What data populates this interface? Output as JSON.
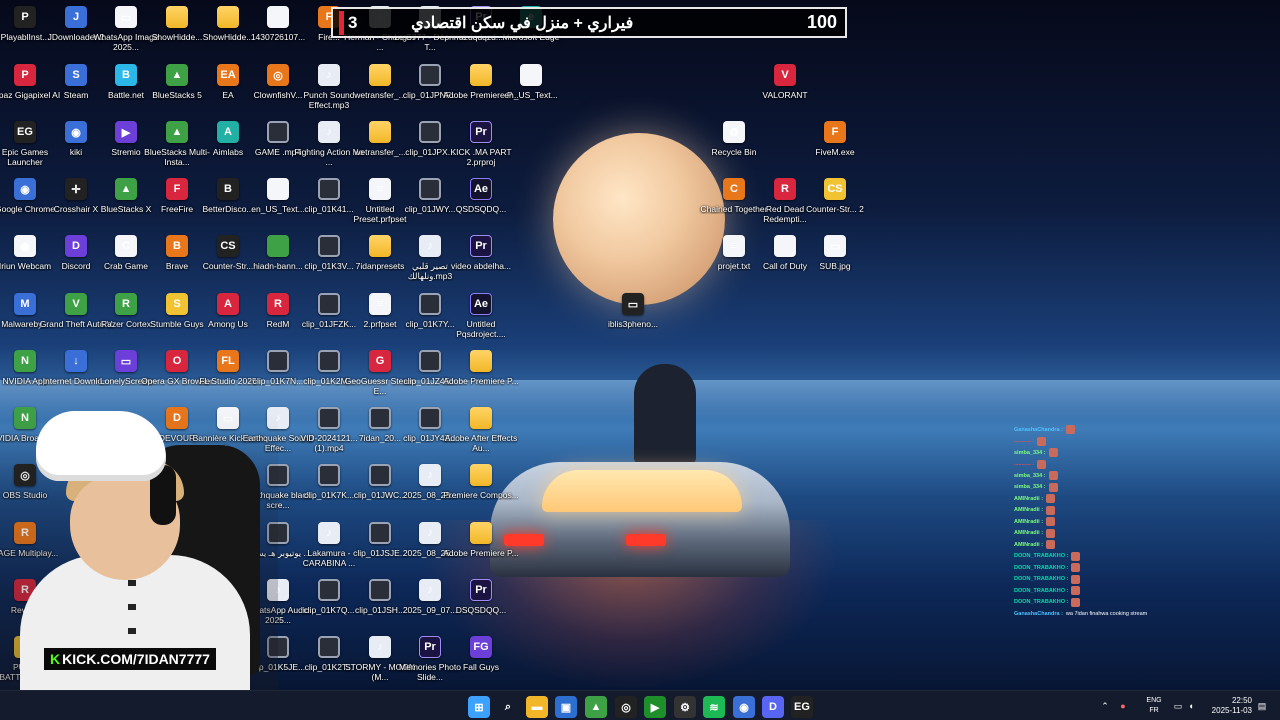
{
  "banner": {
    "left_count": "3",
    "title": "فيراري + منزل في سكن اقتصادي",
    "right_count": "100"
  },
  "overlay": {
    "kick_prefix": "K",
    "kick_text": "KICK.COM/7IDAN7777"
  },
  "desktop": {
    "icons": [
      {
        "label": "PlayablInst...",
        "icon": "steam-icon",
        "kind": "dark",
        "glyph": "P"
      },
      {
        "label": "JDownloader 2",
        "icon": "jdownloader-icon",
        "kind": "app",
        "glyph": "J"
      },
      {
        "label": "WhatsApp Image 2025...",
        "icon": "image-icon",
        "kind": "doc",
        "glyph": "▭"
      },
      {
        "label": "ShowHidde...",
        "icon": "folder-icon",
        "kind": "folder",
        "glyph": ""
      },
      {
        "label": "ShowHidde...",
        "icon": "folder-icon",
        "kind": "folder",
        "glyph": ""
      },
      {
        "label": "1430726107...",
        "icon": "file-icon",
        "kind": "doc",
        "glyph": ""
      },
      {
        "label": "Fire...",
        "icon": "firefox-icon",
        "kind": "orange",
        "glyph": "F"
      },
      {
        "label": "Herman - Changes ...",
        "icon": "audio-icon",
        "kind": "audio",
        "glyph": "♪"
      },
      {
        "label": "Le S777 - Déprimé T...",
        "icon": "audio-icon",
        "kind": "audio",
        "glyph": "♪"
      },
      {
        "label": "azdqdqzd...",
        "icon": "premiere-icon",
        "kind": "pr",
        "glyph": "Pr"
      },
      {
        "label": "Microsoft Edge",
        "icon": "edge-icon",
        "kind": "teal",
        "glyph": "e"
      },
      {
        "label": "Topaz Gigapixel AI",
        "icon": "topaz-icon",
        "kind": "red",
        "glyph": "P"
      },
      {
        "label": "Steam",
        "icon": "steam-icon",
        "kind": "app",
        "glyph": "S"
      },
      {
        "label": "Battle.net",
        "icon": "battlenet-icon",
        "kind": "cyan",
        "glyph": "B"
      },
      {
        "label": "BlueStacks 5",
        "icon": "bluestacks-icon",
        "kind": "green",
        "glyph": "▲"
      },
      {
        "label": "EA",
        "icon": "ea-icon",
        "kind": "orange",
        "glyph": "EA"
      },
      {
        "label": "ClownfishV...",
        "icon": "clownfish-icon",
        "kind": "orange",
        "glyph": "◎"
      },
      {
        "label": "Punch Sound Effect.mp3",
        "icon": "audio-icon",
        "kind": "audio",
        "glyph": "♪"
      },
      {
        "label": "wetransfer_...",
        "icon": "folder-icon",
        "kind": "folder",
        "glyph": ""
      },
      {
        "label": "clip_01JPNF...",
        "icon": "video-icon",
        "kind": "video",
        "glyph": ""
      },
      {
        "label": "Adobe Premiere P...",
        "icon": "folder-icon",
        "kind": "folder",
        "glyph": ""
      },
      {
        "label": "en_US_Text...",
        "icon": "file-icon",
        "kind": "doc",
        "glyph": ""
      },
      {
        "label": "VALORANT",
        "icon": "valorant-icon",
        "kind": "red",
        "glyph": "V"
      },
      {
        "label": "Epic Games Launcher",
        "icon": "epic-games-icon",
        "kind": "dark",
        "glyph": "EG"
      },
      {
        "label": "kiki",
        "icon": "chrome-icon",
        "kind": "app",
        "glyph": "◉"
      },
      {
        "label": "Stremio",
        "icon": "stremio-icon",
        "kind": "purple",
        "glyph": "▶"
      },
      {
        "label": "BlueStacks Multi-Insta...",
        "icon": "bluestacks-icon",
        "kind": "green",
        "glyph": "▲"
      },
      {
        "label": "Aimlabs",
        "icon": "aimlabs-icon",
        "kind": "teal",
        "glyph": "A"
      },
      {
        "label": "GAME .mp4",
        "icon": "video-icon",
        "kind": "video",
        "glyph": ""
      },
      {
        "label": "Fighting Action No ...",
        "icon": "audio-icon",
        "kind": "audio",
        "glyph": "♪"
      },
      {
        "label": "wetransfer_...",
        "icon": "folder-icon",
        "kind": "folder",
        "glyph": ""
      },
      {
        "label": "clip_01JPX...",
        "icon": "video-icon",
        "kind": "video",
        "glyph": ""
      },
      {
        "label": "KICK .MA PART 2.prproj",
        "icon": "premiere-icon",
        "kind": "pr",
        "glyph": "Pr"
      },
      {
        "label": "Recycle Bin",
        "icon": "recycle-bin-icon",
        "kind": "doc",
        "glyph": "♻"
      },
      {
        "label": "FiveM.exe",
        "icon": "fivem-icon",
        "kind": "orange",
        "glyph": "F"
      },
      {
        "label": "Google Chrome",
        "icon": "chrome-icon",
        "kind": "app",
        "glyph": "◉"
      },
      {
        "label": "Crosshair X",
        "icon": "crosshair-icon",
        "kind": "dark",
        "glyph": "✛"
      },
      {
        "label": "BlueStacks X",
        "icon": "bluestacks-icon",
        "kind": "green",
        "glyph": "▲"
      },
      {
        "label": "FreeFire",
        "icon": "freefire-icon",
        "kind": "red",
        "glyph": "F"
      },
      {
        "label": "BetterDisco...",
        "icon": "discord-icon",
        "kind": "dark",
        "glyph": "B"
      },
      {
        "label": "en_US_Text...",
        "icon": "file-icon",
        "kind": "doc",
        "glyph": ""
      },
      {
        "label": "clip_01K41...",
        "icon": "video-icon",
        "kind": "video",
        "glyph": ""
      },
      {
        "label": "Untitled Preset.prfpset",
        "icon": "preset-icon",
        "kind": "doc",
        "glyph": "≡"
      },
      {
        "label": "clip_01JWY...",
        "icon": "video-icon",
        "kind": "video",
        "glyph": ""
      },
      {
        "label": "QSDSQDQ...",
        "icon": "after-effects-icon",
        "kind": "ae",
        "glyph": "Ae"
      },
      {
        "label": "Chained Together",
        "icon": "game-icon",
        "kind": "orange",
        "glyph": "C"
      },
      {
        "label": "Red Dead Redempti...",
        "icon": "rdr-icon",
        "kind": "red",
        "glyph": "R"
      },
      {
        "label": "Counter-Str... 2",
        "icon": "cs2-icon",
        "kind": "yellow",
        "glyph": "CS"
      },
      {
        "label": "Iriun Webcam",
        "icon": "webcam-icon",
        "kind": "doc",
        "glyph": "◉"
      },
      {
        "label": "Discord",
        "icon": "discord-icon",
        "kind": "purple",
        "glyph": "D"
      },
      {
        "label": "Crab Game",
        "icon": "game-icon",
        "kind": "doc",
        "glyph": "C"
      },
      {
        "label": "Brave",
        "icon": "brave-icon",
        "kind": "orange",
        "glyph": "B"
      },
      {
        "label": "Counter-Str...",
        "icon": "cs-icon",
        "kind": "dark",
        "glyph": "CS"
      },
      {
        "label": "hiadn-bann...",
        "icon": "image-icon",
        "kind": "green",
        "glyph": ""
      },
      {
        "label": "clip_01K3V...",
        "icon": "video-icon",
        "kind": "video",
        "glyph": ""
      },
      {
        "label": "7idanpresets",
        "icon": "folder-icon",
        "kind": "folder",
        "glyph": ""
      },
      {
        "label": "تصير قلبي ونلهالك.mp3",
        "icon": "audio-icon",
        "kind": "audio",
        "glyph": "♪"
      },
      {
        "label": "video abdelha...",
        "icon": "premiere-icon",
        "kind": "pr",
        "glyph": "Pr"
      },
      {
        "label": "projet.txt",
        "icon": "text-file-icon",
        "kind": "doc",
        "glyph": "≡"
      },
      {
        "label": "Call of Duty",
        "icon": "file-icon",
        "kind": "doc",
        "glyph": ""
      },
      {
        "label": "SUB.jpg",
        "icon": "image-icon",
        "kind": "doc",
        "glyph": "▭"
      },
      {
        "label": "Malwareby...",
        "icon": "malwarebytes-icon",
        "kind": "app",
        "glyph": "M"
      },
      {
        "label": "Grand Theft Auto V",
        "icon": "gta-icon",
        "kind": "green",
        "glyph": "V"
      },
      {
        "label": "Razer Cortex",
        "icon": "razer-icon",
        "kind": "green",
        "glyph": "R"
      },
      {
        "label": "Stumble Guys",
        "icon": "stumble-guys-icon",
        "kind": "yellow",
        "glyph": "S"
      },
      {
        "label": "Among Us",
        "icon": "among-us-icon",
        "kind": "red",
        "glyph": "A"
      },
      {
        "label": "RedM",
        "icon": "redm-icon",
        "kind": "red",
        "glyph": "R"
      },
      {
        "label": "clip_01JFZK...",
        "icon": "video-icon",
        "kind": "video",
        "glyph": ""
      },
      {
        "label": "2.prfpset",
        "icon": "preset-icon",
        "kind": "doc",
        "glyph": "≡"
      },
      {
        "label": "clip_01K7Y...",
        "icon": "video-icon",
        "kind": "video",
        "glyph": ""
      },
      {
        "label": "Untitled Pqsdroject....",
        "icon": "after-effects-icon",
        "kind": "ae",
        "glyph": "Ae"
      },
      {
        "label": "iblis3pheno...",
        "icon": "image-icon",
        "kind": "dark",
        "glyph": "▭"
      },
      {
        "label": "NVIDIA App",
        "icon": "nvidia-icon",
        "kind": "green",
        "glyph": "N"
      },
      {
        "label": "Internet Downlo...",
        "icon": "idm-icon",
        "kind": "app",
        "glyph": "↓"
      },
      {
        "label": "LonelyScreen",
        "icon": "lonelyscreen-icon",
        "kind": "purple",
        "glyph": "▭"
      },
      {
        "label": "Opera GX Browser",
        "icon": "opera-gx-icon",
        "kind": "red",
        "glyph": "O"
      },
      {
        "label": "FL Studio 2025",
        "icon": "fl-studio-icon",
        "kind": "orange",
        "glyph": "FL"
      },
      {
        "label": "clip_01K7N...",
        "icon": "video-icon",
        "kind": "video",
        "glyph": ""
      },
      {
        "label": "clip_01K2M...",
        "icon": "video-icon",
        "kind": "video",
        "glyph": ""
      },
      {
        "label": "GeoGuessr Steam E...",
        "icon": "geoguessr-icon",
        "kind": "red",
        "glyph": "G"
      },
      {
        "label": "clip_01JZ45...",
        "icon": "video-icon",
        "kind": "video",
        "glyph": ""
      },
      {
        "label": "Adobe Premiere P...",
        "icon": "folder-icon",
        "kind": "folder",
        "glyph": ""
      },
      {
        "label": "NVIDIA Broadcast",
        "icon": "nvidia-icon",
        "kind": "green",
        "glyph": "N"
      },
      {
        "label": "DEVOUR",
        "icon": "devour-icon",
        "kind": "orange",
        "glyph": "D"
      },
      {
        "label": "Bannière Kick.com d...",
        "icon": "file-icon",
        "kind": "doc",
        "glyph": "▭"
      },
      {
        "label": "Earthquake Sound Effec...",
        "icon": "audio-icon",
        "kind": "audio",
        "glyph": "♪"
      },
      {
        "label": "VID-2024121... (1).mp4",
        "icon": "video-icon",
        "kind": "video",
        "glyph": ""
      },
      {
        "label": "7idan_20...",
        "icon": "video-icon",
        "kind": "video",
        "glyph": ""
      },
      {
        "label": "clip_01JY4Z...",
        "icon": "video-icon",
        "kind": "video",
        "glyph": ""
      },
      {
        "label": "Adobe After Effects Au...",
        "icon": "folder-icon",
        "kind": "folder",
        "glyph": ""
      },
      {
        "label": "OBS Studio",
        "icon": "obs-icon",
        "kind": "dark",
        "glyph": "◎"
      },
      {
        "label": "..._files",
        "icon": "folder-icon",
        "kind": "folder",
        "glyph": ""
      },
      {
        "label": "Earthquake black scre...",
        "icon": "video-icon",
        "kind": "video",
        "glyph": ""
      },
      {
        "label": "clip_01K7K...",
        "icon": "video-icon",
        "kind": "video",
        "glyph": ""
      },
      {
        "label": "clip_01JWC...",
        "icon": "video-icon",
        "kind": "video",
        "glyph": ""
      },
      {
        "label": "2025_08_25...",
        "icon": "audio-icon",
        "kind": "audio",
        "glyph": "♪"
      },
      {
        "label": "Premiere Compos...",
        "icon": "folder-icon",
        "kind": "folder",
        "glyph": ""
      },
      {
        "label": "RAGE Multiplay...",
        "icon": "rage-icon",
        "kind": "orange",
        "glyph": "R"
      },
      {
        "label": "يوتيوبر هـ يسبب ...",
        "icon": "video-icon",
        "kind": "video",
        "glyph": ""
      },
      {
        "label": "Lakamura - CARABINA ...",
        "icon": "audio-icon",
        "kind": "audio",
        "glyph": "♪"
      },
      {
        "label": "clip_01JSJE...",
        "icon": "video-icon",
        "kind": "video",
        "glyph": ""
      },
      {
        "label": "2025_08_25...",
        "icon": "audio-icon",
        "kind": "audio",
        "glyph": "♪"
      },
      {
        "label": "Adobe Premiere P...",
        "icon": "folder-icon",
        "kind": "folder",
        "glyph": ""
      },
      {
        "label": "Revis...",
        "icon": "app-icon",
        "kind": "red",
        "glyph": "R"
      },
      {
        "label": "WhatsApp Audio 2025...",
        "icon": "audio-icon",
        "kind": "audio",
        "glyph": "♪"
      },
      {
        "label": "clip_01K7Q...",
        "icon": "video-icon",
        "kind": "video",
        "glyph": ""
      },
      {
        "label": "clip_01JSH...",
        "icon": "video-icon",
        "kind": "video",
        "glyph": ""
      },
      {
        "label": "2025_09_07...",
        "icon": "audio-icon",
        "kind": "audio",
        "glyph": "♪"
      },
      {
        "label": "DSQSDQQ...",
        "icon": "premiere-icon",
        "kind": "pr",
        "glyph": "Pr"
      },
      {
        "label": "PUBG BATTLEGR...",
        "icon": "pubg-icon",
        "kind": "yellow",
        "glyph": "P"
      },
      {
        "label": "NVIDIA GeFor...",
        "icon": "nvidia-icon",
        "kind": "green",
        "glyph": "N"
      },
      {
        "label": "(1).mp4",
        "icon": "video-icon",
        "kind": "video",
        "glyph": ""
      },
      {
        "label": "Gentleme...",
        "icon": "video-icon",
        "kind": "video",
        "glyph": ""
      },
      {
        "label": "...net-S...",
        "icon": "battlenet-icon",
        "kind": "cyan",
        "glyph": "B"
      },
      {
        "label": "clip_01K5JE...",
        "icon": "video-icon",
        "kind": "video",
        "glyph": ""
      },
      {
        "label": "clip_01K2T...",
        "icon": "video-icon",
        "kind": "video",
        "glyph": ""
      },
      {
        "label": "STORMY - MOON (M...",
        "icon": "audio-icon",
        "kind": "audio",
        "glyph": "♪"
      },
      {
        "label": "Memories Photo Slide...",
        "icon": "premiere-icon",
        "kind": "pr",
        "glyph": "Pr"
      },
      {
        "label": "Fall Guys",
        "icon": "fall-guys-icon",
        "kind": "purple",
        "glyph": "FG"
      }
    ]
  },
  "chat": [
    {
      "user": "GanashaChandra :",
      "color": "#4fc3ff",
      "msg": "",
      "emote": true
    },
    {
      "user": "........... :",
      "color": "#ff4a4a",
      "msg": "",
      "emote": true
    },
    {
      "user": "simba_334 :",
      "color": "#7cff7c",
      "msg": "",
      "emote": true
    },
    {
      "user": "........... :",
      "color": "#ff4a4a",
      "msg": "",
      "emote": true
    },
    {
      "user": "simba_334 :",
      "color": "#7cff7c",
      "msg": "",
      "emote": true
    },
    {
      "user": "simba_334 :",
      "color": "#7cff7c",
      "msg": "",
      "emote": true
    },
    {
      "user": "AMINradii :",
      "color": "#7cff7c",
      "msg": "",
      "emote": true
    },
    {
      "user": "AMINradii :",
      "color": "#7cff7c",
      "msg": "",
      "emote": true
    },
    {
      "user": "AMINradii :",
      "color": "#7cff7c",
      "msg": "",
      "emote": true
    },
    {
      "user": "AMINradii :",
      "color": "#7cff7c",
      "msg": "",
      "emote": true
    },
    {
      "user": "AMINradii :",
      "color": "#7cff7c",
      "msg": "",
      "emote": true
    },
    {
      "user": "DOON_TRABAKHO :",
      "color": "#00e0a8",
      "msg": "",
      "emote": true
    },
    {
      "user": "DOON_TRABAKHO :",
      "color": "#00e0a8",
      "msg": "",
      "emote": true
    },
    {
      "user": "DOON_TRABAKHO :",
      "color": "#00e0a8",
      "msg": "",
      "emote": true
    },
    {
      "user": "DOON_TRABAKHO :",
      "color": "#00e0a8",
      "msg": "",
      "emote": true
    },
    {
      "user": "DOON_TRABAKHO :",
      "color": "#00e0a8",
      "msg": "",
      "emote": true
    },
    {
      "user": "GanashaChandra :",
      "color": "#4fc3ff",
      "msg": "wa 7idan finahwa cooking stream",
      "emote": false
    }
  ],
  "taskbar": {
    "apps": [
      {
        "name": "start-button-icon",
        "glyph": "⊞",
        "color": "#3da2ff"
      },
      {
        "name": "search-icon",
        "glyph": "⌕",
        "color": "transparent"
      },
      {
        "name": "file-explorer-icon",
        "glyph": "▬",
        "color": "#f2b728"
      },
      {
        "name": "store-icon",
        "glyph": "▣",
        "color": "#2d6fd0"
      },
      {
        "name": "bluestacks-icon",
        "glyph": "▲",
        "color": "#3ea146"
      },
      {
        "name": "obs-icon",
        "glyph": "◎",
        "color": "#222"
      },
      {
        "name": "aimlabs-icon",
        "glyph": "▶",
        "color": "#1f8f2c"
      },
      {
        "name": "settings-icon",
        "glyph": "⚙",
        "color": "#333"
      },
      {
        "name": "spotify-icon",
        "glyph": "≋",
        "color": "#1db954"
      },
      {
        "name": "chrome-icon",
        "glyph": "◉",
        "color": "#3a6fd8"
      },
      {
        "name": "discord-icon",
        "glyph": "D",
        "color": "#5865f2"
      },
      {
        "name": "epic-games-icon",
        "glyph": "EG",
        "color": "#222"
      }
    ],
    "language": "ENG",
    "keyboard": "FR",
    "time": "22:50",
    "date": "2025-11-03"
  }
}
